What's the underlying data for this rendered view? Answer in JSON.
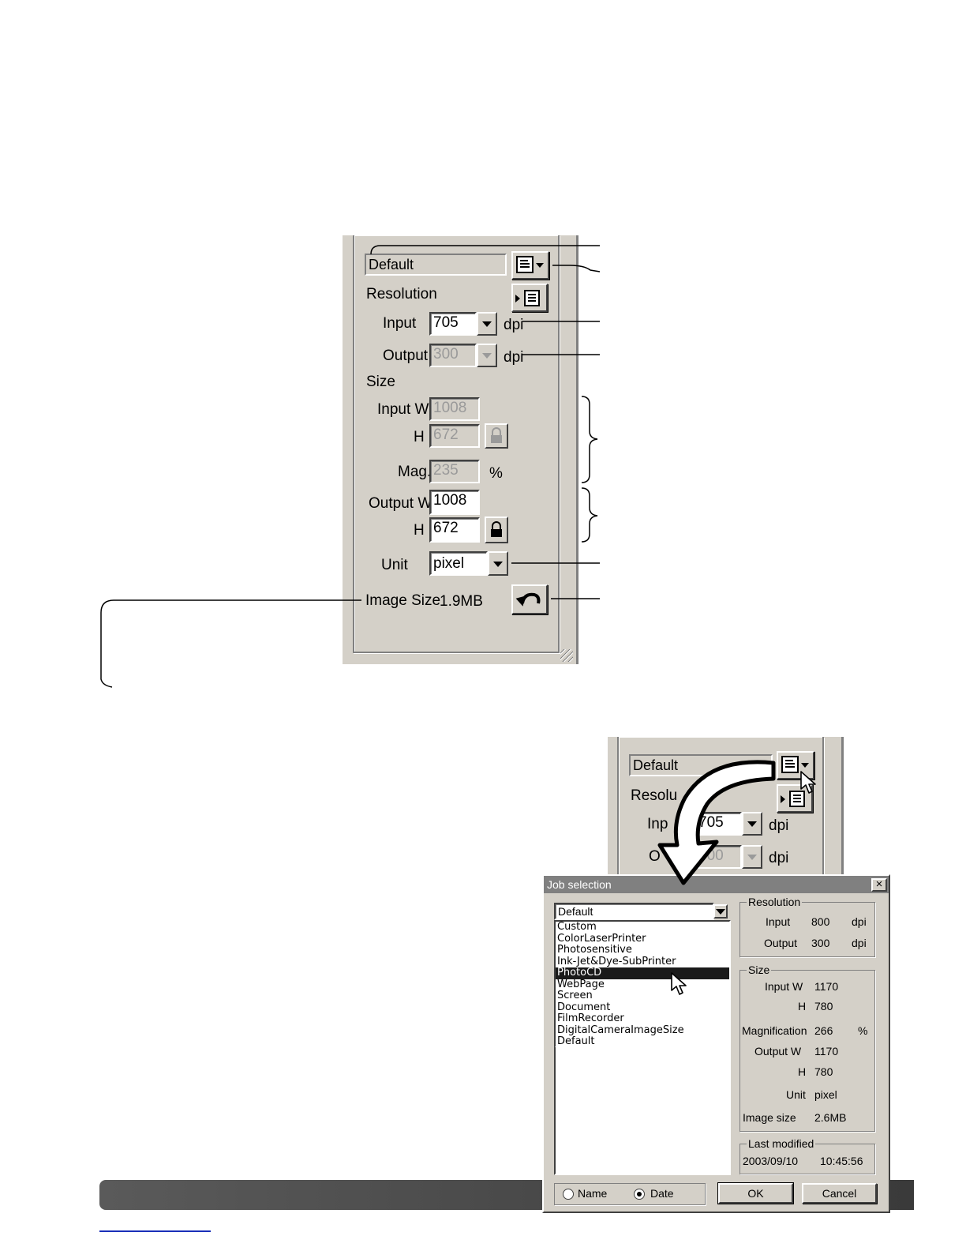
{
  "panel": {
    "job_field": "Default",
    "resolution_label": "Resolution",
    "input_label": "Input",
    "input_value": "705",
    "output_label": "Output",
    "output_value": "300",
    "dpi_unit": "dpi",
    "size_label": "Size",
    "input_w_label": "Input W",
    "input_w_value": "1008",
    "h_label": "H",
    "input_h_value": "672",
    "mag_label": "Mag.",
    "mag_value": "235",
    "percent": "%",
    "output_w_label": "Output W",
    "output_w_value": "1008",
    "output_h_value": "672",
    "unit_label": "Unit",
    "unit_value": "pixel",
    "image_size_label": "Image Size",
    "image_size_value": "1.9MB"
  },
  "panel2": {
    "job_field": "Default",
    "resolution_label": "Resolu",
    "input_label": "Inp",
    "input_value": "705",
    "output_label": "O",
    "output_value": "300",
    "dpi_unit": "dpi"
  },
  "dialog": {
    "title": "Job selection",
    "close": "×",
    "combo_value": "Default",
    "list_items": [
      "Custom",
      "ColorLaserPrinter",
      "Photosensitive",
      "Ink-Jet&Dye-SubPrinter",
      "PhotoCD",
      "WebPage",
      "Screen",
      "Document",
      "FilmRecorder",
      "DigitalCameraImageSize",
      "Default"
    ],
    "selected_item": "PhotoCD",
    "resolution_group": "Resolution",
    "res_input_label": "Input",
    "res_input_value": "800",
    "res_output_label": "Output",
    "res_output_value": "300",
    "dpi": "dpi",
    "size_group": "Size",
    "size_input_w_label": "Input W",
    "size_input_w_value": "1170",
    "h_label": "H",
    "size_input_h_value": "780",
    "magnification_label": "Magnification",
    "magnification_value": "266",
    "percent": "%",
    "size_output_w_label": "Output W",
    "size_output_w_value": "1170",
    "size_output_h_value": "780",
    "unit_label": "Unit",
    "unit_value": "pixel",
    "image_size_label": "Image size",
    "image_size_value": "2.6MB",
    "last_modified_group": "Last modified",
    "last_modified_date": "2003/09/10",
    "last_modified_time": "10:45:56",
    "sort_name": "Name",
    "sort_date": "Date",
    "sort_selected": "Date",
    "ok": "OK",
    "cancel": "Cancel"
  },
  "colors": {
    "panel_bg": "#d4d0c8",
    "footer_bar": "#4a4a4a",
    "link_line": "#1a2fb8"
  },
  "icons": [
    "job-menu-icon",
    "save-job-icon",
    "lock-icon",
    "reset-arrow-icon",
    "mouse-pointer-icon",
    "curved-arrow-icon"
  ]
}
